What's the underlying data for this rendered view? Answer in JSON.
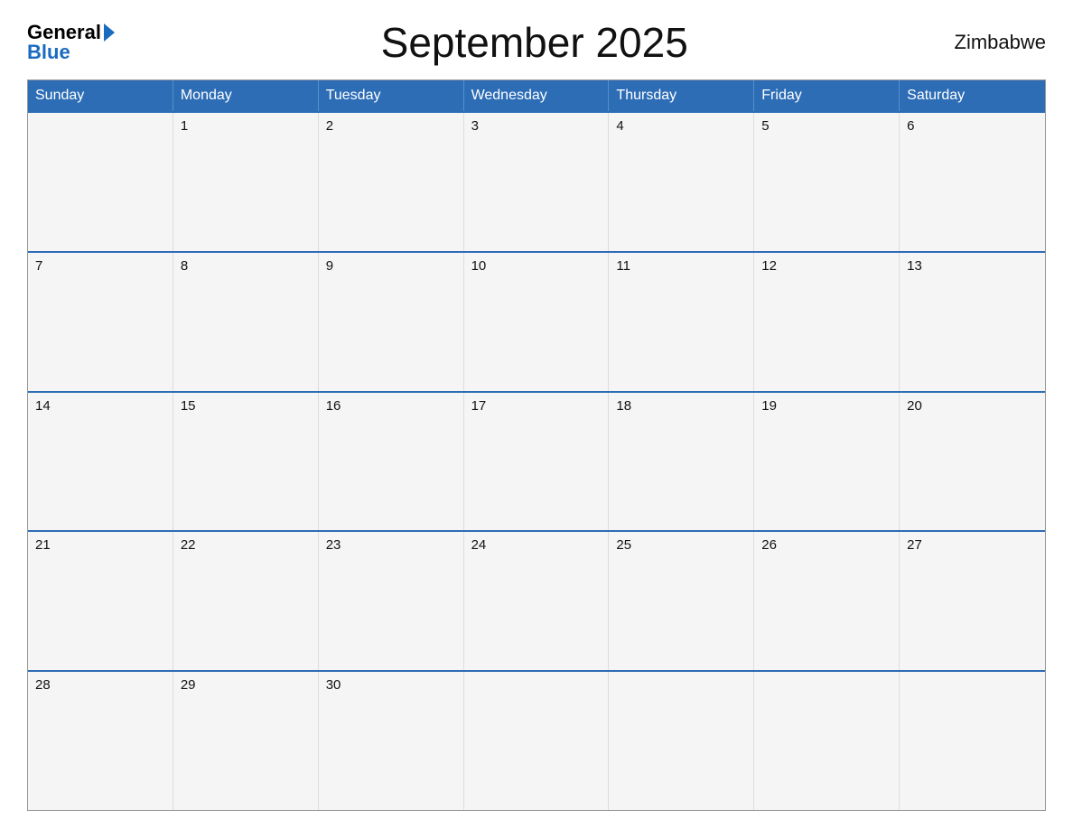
{
  "header": {
    "title": "September 2025",
    "country": "Zimbabwe",
    "logo": {
      "general": "General",
      "blue": "Blue"
    }
  },
  "days_of_week": [
    "Sunday",
    "Monday",
    "Tuesday",
    "Wednesday",
    "Thursday",
    "Friday",
    "Saturday"
  ],
  "weeks": [
    [
      {
        "num": "",
        "empty": true
      },
      {
        "num": "1"
      },
      {
        "num": "2"
      },
      {
        "num": "3"
      },
      {
        "num": "4"
      },
      {
        "num": "5"
      },
      {
        "num": "6"
      }
    ],
    [
      {
        "num": "7"
      },
      {
        "num": "8"
      },
      {
        "num": "9"
      },
      {
        "num": "10"
      },
      {
        "num": "11"
      },
      {
        "num": "12"
      },
      {
        "num": "13"
      }
    ],
    [
      {
        "num": "14"
      },
      {
        "num": "15"
      },
      {
        "num": "16"
      },
      {
        "num": "17"
      },
      {
        "num": "18"
      },
      {
        "num": "19"
      },
      {
        "num": "20"
      }
    ],
    [
      {
        "num": "21"
      },
      {
        "num": "22"
      },
      {
        "num": "23"
      },
      {
        "num": "24"
      },
      {
        "num": "25"
      },
      {
        "num": "26"
      },
      {
        "num": "27"
      }
    ],
    [
      {
        "num": "28"
      },
      {
        "num": "29"
      },
      {
        "num": "30"
      },
      {
        "num": "",
        "empty": true
      },
      {
        "num": "",
        "empty": true
      },
      {
        "num": "",
        "empty": true
      },
      {
        "num": "",
        "empty": true
      }
    ]
  ]
}
